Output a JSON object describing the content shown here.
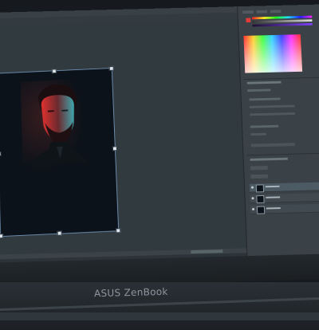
{
  "laptop": {
    "brand": "ASUS ZenBook"
  },
  "editor": {
    "canvas_bg": "#313a3f",
    "artboard_bg": "#0b1219",
    "selection_color": "#6f8fb0",
    "portrait_light_left": "#e0312f",
    "portrait_light_right": "#3fa8b0"
  },
  "panel": {
    "layers": [
      {
        "name": "",
        "active": true
      },
      {
        "name": "",
        "active": false
      },
      {
        "name": "",
        "active": false
      }
    ]
  },
  "icons": [
    "mouse-cursor-icon",
    "eye-icon"
  ]
}
